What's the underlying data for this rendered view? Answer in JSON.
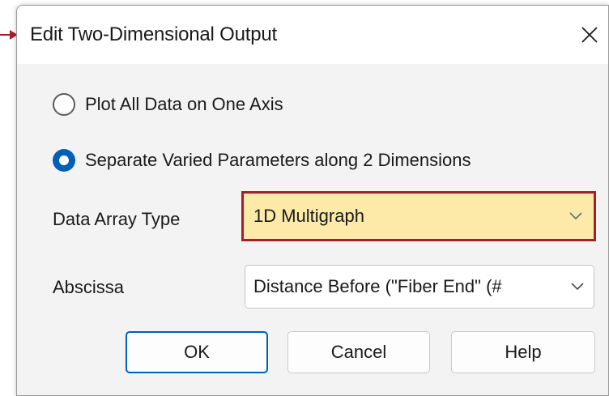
{
  "dialog": {
    "title": "Edit Two-Dimensional Output"
  },
  "options": {
    "plot_all": {
      "label": "Plot All Data on One Axis",
      "selected": false
    },
    "separate": {
      "label": "Separate Varied Parameters along 2 Dimensions",
      "selected": true
    }
  },
  "data_array_type": {
    "label": "Data Array Type",
    "value": "1D Multigraph"
  },
  "abscissa": {
    "label": "Abscissa",
    "value": "Distance Before (\"Fiber End\" (#"
  },
  "buttons": {
    "ok": "OK",
    "cancel": "Cancel",
    "help": "Help"
  },
  "icons": {
    "close": "close-icon",
    "dropdown": "chevron-down-icon",
    "pointer": "pointer-arrow-icon"
  },
  "colors": {
    "accent": "#005fb8",
    "highlight_border": "#a3202a",
    "highlight_fill": "#fde9a8"
  }
}
